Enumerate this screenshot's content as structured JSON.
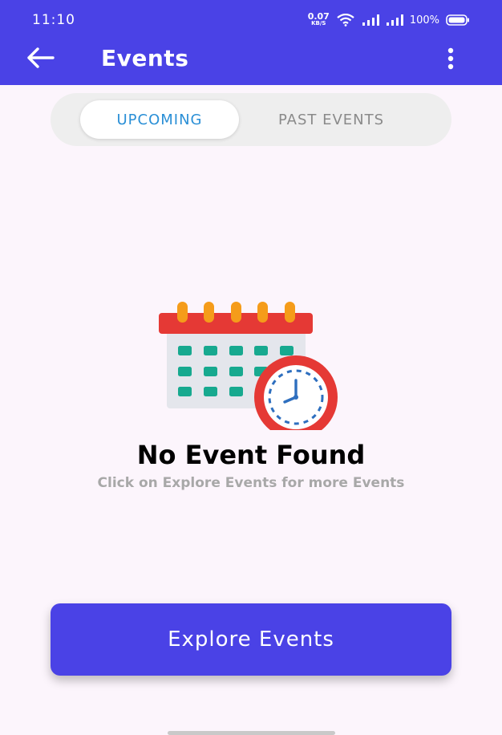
{
  "status_bar": {
    "time": "11:10",
    "net_speed_value": "0.07",
    "net_speed_unit": "KB/S",
    "battery_percent": "100%",
    "icons": [
      "wifi-icon",
      "signal-icon",
      "signal-icon",
      "battery-icon"
    ]
  },
  "toolbar": {
    "title": "Events",
    "back_icon": "arrow-left-icon",
    "menu_icon": "more-vertical-icon"
  },
  "tabs": [
    {
      "label": "UPCOMING",
      "active": true
    },
    {
      "label": "PAST EVENTS",
      "active": false
    }
  ],
  "empty_state": {
    "icon": "calendar-clock-icon",
    "title": "No Event Found",
    "subtitle": "Click on Explore Events for more Events"
  },
  "explore_button": {
    "label": "Explore Events"
  },
  "colors": {
    "primary": "#4a42e6",
    "background": "#fcf5fc",
    "active_tab_text": "#2a8fd6",
    "inactive_tab_text": "#8a8a8a",
    "calendar_header": "#e53935",
    "calendar_rings": "#f59c1a",
    "calendar_dots": "#17a98f",
    "clock_ring": "#e53935"
  }
}
